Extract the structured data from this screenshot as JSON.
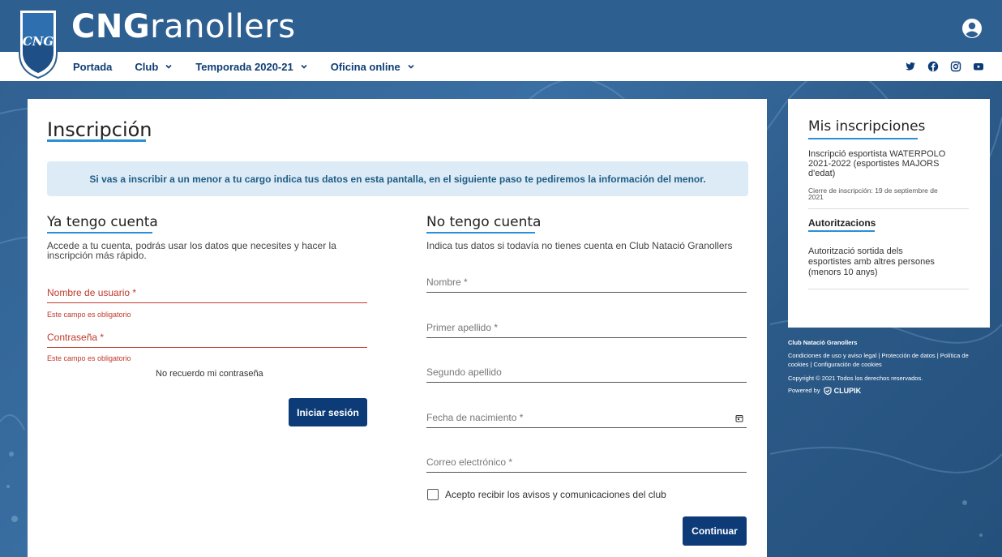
{
  "brand": {
    "bold": "CNG",
    "light": "ranollers",
    "logo_text": "CNG"
  },
  "nav": {
    "items": [
      {
        "label": "Portada",
        "has_dropdown": false
      },
      {
        "label": "Club",
        "has_dropdown": true
      },
      {
        "label": "Temporada 2020-21",
        "has_dropdown": true
      },
      {
        "label": "Oficina online",
        "has_dropdown": true
      }
    ],
    "socials": [
      "twitter-icon",
      "facebook-icon",
      "instagram-icon",
      "youtube-icon"
    ]
  },
  "main": {
    "title": "Inscripción",
    "info": "Si vas a inscribir a un menor a tu cargo indica tus datos en esta pantalla, en el siguiente paso te pediremos la información del menor.",
    "login": {
      "title": "Ya tengo cuenta",
      "desc_line1": "Accede a tu cuenta, podrás usar los datos que necesites y hacer la",
      "desc_line2": "inscripción más rápido.",
      "username_label": "Nombre de usuario *",
      "password_label": "Contraseña *",
      "error": "Este campo es obligatorio",
      "forgot": "No recuerdo mi contraseña",
      "submit": "Iniciar sesión"
    },
    "register": {
      "title": "No tengo cuenta",
      "desc": "Indica tus datos si todavía no tienes cuenta en Club Natació Granollers",
      "fields": [
        "Nombre *",
        "Primer apellido *",
        "Segundo apellido",
        "Fecha de nacimiento *",
        "Correo electrónico *"
      ],
      "consent": "Acepto recibir los avisos y comunicaciones del club",
      "submit": "Continuar"
    }
  },
  "sidebar": {
    "title": "Mis inscripciones",
    "item1_line1": "Inscripció esportista WATERPOLO",
    "item1_line2": "2021-2022 (esportistes MAJORS",
    "item1_line3": "d'edat)",
    "item1_sub1": "Cierre de inscripción: 19 de septiembre de",
    "item1_sub2": "2021",
    "section": "Autoritzacions",
    "item2_line1": "Autorització sortida dels",
    "item2_line2": "esportistes amb altres persones",
    "item2_line3": "(menors 10 anys)"
  },
  "footer": {
    "club": "Club Natació Granollers",
    "links1": "Condiciones de uso y aviso legal | Protección de datos | Política de",
    "links2": "cookies | Configuración de cookies",
    "copyright": "Copyright © 2021 Todos los derechos reservados.",
    "powered_prefix": "Powered by",
    "powered_brand": "CLUPIK"
  },
  "colors": {
    "primary": "#0c3b78",
    "header": "#2e5f91",
    "accent": "#2a8fd6",
    "error": "#c0392b",
    "info_bg": "#dcebf5"
  }
}
